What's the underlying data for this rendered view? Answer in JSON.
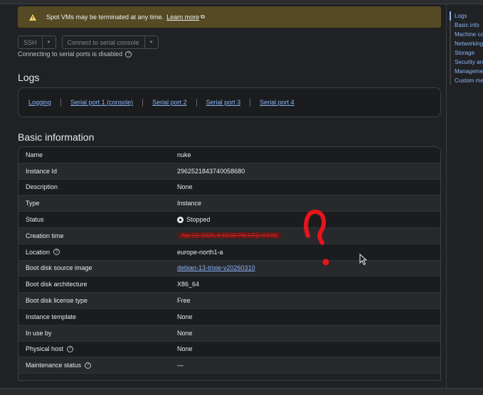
{
  "banner": {
    "text": "Spot VMs may be terminated at any time.",
    "link": "Learn more"
  },
  "buttons": {
    "ssh": "SSH",
    "serial": "Connect to serial console"
  },
  "serial_note": "Connecting to serial ports is disabled",
  "logs": {
    "title": "Logs",
    "links": [
      "Logging",
      "Serial port 1 (console)",
      "Serial port 2",
      "Serial port 3",
      "Serial port 4"
    ]
  },
  "basic": {
    "title": "Basic information",
    "rows": [
      {
        "key": "Name",
        "value": "nuke"
      },
      {
        "key": "Instance Id",
        "value": "2962521843740058680"
      },
      {
        "key": "Description",
        "value": "None"
      },
      {
        "key": "Type",
        "value": "Instance"
      },
      {
        "key": "Status",
        "value": "Stopped"
      },
      {
        "key": "Creation time",
        "value": "Apr 12, 2026, 4:15:03 PM UTC+03:00"
      },
      {
        "key": "Location",
        "value": "europe-north1-a"
      },
      {
        "key": "Boot disk source image",
        "value": "debian-13-trixie-v20260310"
      },
      {
        "key": "Boot disk architecture",
        "value": "X86_64"
      },
      {
        "key": "Boot disk license type",
        "value": "Free"
      },
      {
        "key": "Instance template",
        "value": "None"
      },
      {
        "key": "In use by",
        "value": "None"
      },
      {
        "key": "Physical host",
        "value": "None"
      },
      {
        "key": "Maintenance status",
        "value": "—"
      }
    ]
  },
  "toc": [
    "Logs",
    "Basic info",
    "Machine configuration",
    "Networking",
    "Storage",
    "Security and access",
    "Management",
    "Custom metadata"
  ],
  "colors": {
    "accent": "#8ab4f8",
    "banner_bg": "#554a23",
    "annotation": "#e8141b"
  }
}
